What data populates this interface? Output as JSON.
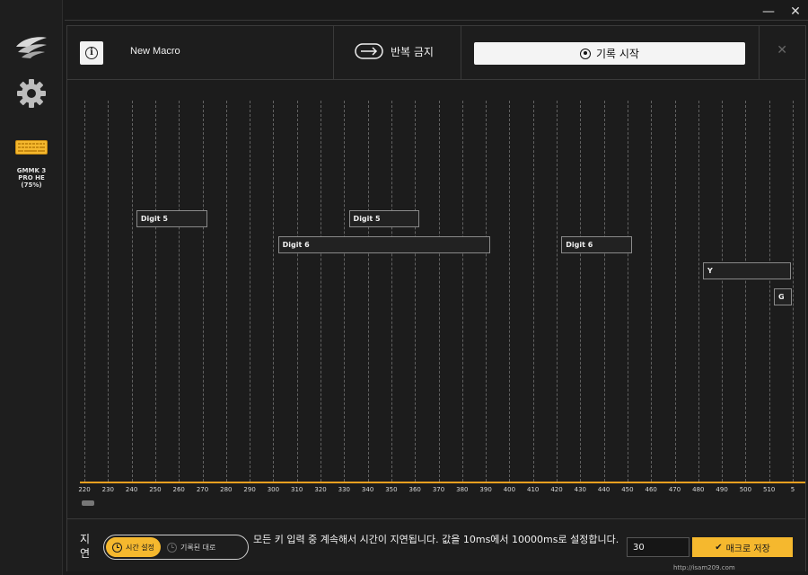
{
  "window": {
    "minimize_glyph": "—",
    "close_glyph": "✕"
  },
  "sidebar": {
    "device_label": "GMMK 3\nPRO HE\n(75%)",
    "icons": [
      "logo-wing-icon",
      "settings-gear-icon",
      "keyboard-icon"
    ]
  },
  "toolbar": {
    "info_glyph": "i",
    "macro_name": "New Macro",
    "repeat_label": "반복 금지",
    "record_label": "기록 시작",
    "close_glyph": "✕"
  },
  "timeline": {
    "ticks": [
      "220",
      "230",
      "240",
      "250",
      "260",
      "270",
      "280",
      "290",
      "300",
      "310",
      "320",
      "330",
      "340",
      "350",
      "360",
      "370",
      "380",
      "390",
      "400",
      "410",
      "420",
      "430",
      "440",
      "450",
      "460",
      "470",
      "480",
      "490",
      "500",
      "510",
      "5"
    ],
    "events": [
      {
        "label": "Digit 5",
        "start": 242,
        "end": 272,
        "row": 0
      },
      {
        "label": "Digit 6",
        "start": 302,
        "end": 392,
        "row": 1
      },
      {
        "label": "Digit 5",
        "start": 332,
        "end": 362,
        "row": 0
      },
      {
        "label": "Digit 6",
        "start": 422,
        "end": 452,
        "row": 1
      },
      {
        "label": "Y",
        "start": 482,
        "end": 520,
        "row": 2
      },
      {
        "label": "G",
        "start": 512,
        "end": 520,
        "row": 3
      }
    ]
  },
  "footer": {
    "delay_label": "지\n연",
    "toggle_active": "시간 설정",
    "toggle_inactive": "기록된 대로",
    "description": "모든 키 입력 중 계속해서 시간이 지연됩니다. 값을 10ms에서 10000ms로 설정합니다.",
    "delay_value": "30",
    "save_label": "매크로 저장"
  },
  "watermark": {
    "text": "http://isam209.com"
  },
  "colors": {
    "accent": "#f5b82e",
    "baseline": "#f0a020",
    "background": "#1c1c1c"
  }
}
